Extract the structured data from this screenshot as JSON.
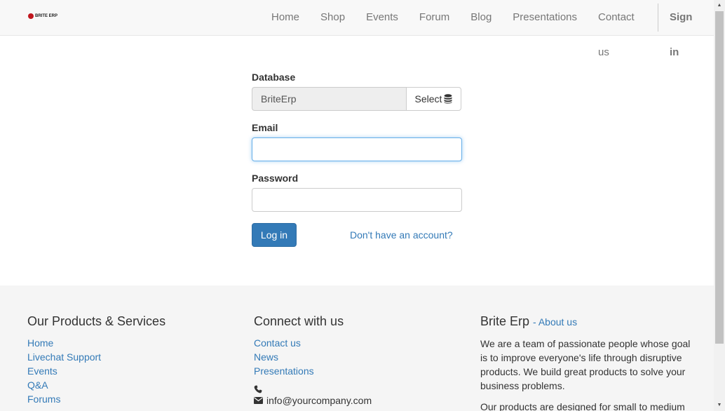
{
  "brand": {
    "logo_text": "BRITE ERP",
    "dot_color": "#c0161e"
  },
  "nav": {
    "items": [
      "Home",
      "Shop",
      "Events",
      "Forum",
      "Blog",
      "Presentations",
      "Contact us"
    ],
    "signin": "Sign in"
  },
  "login": {
    "database_label": "Database",
    "database_value": "BriteErp",
    "select_label": "Select",
    "email_label": "Email",
    "email_value": "",
    "password_label": "Password",
    "password_value": "",
    "login_button": "Log in",
    "signup_link": "Don't have an account?"
  },
  "footer": {
    "col1": {
      "title": "Our Products & Services",
      "links": [
        "Home",
        "Livechat Support",
        "Events",
        "Q&A",
        "Forums"
      ]
    },
    "col2": {
      "title": "Connect with us",
      "links": [
        "Contact us",
        "News",
        "Presentations"
      ],
      "email": "info@yourcompany.com"
    },
    "col3": {
      "title": "Brite Erp",
      "about_link": "- About us",
      "para1": "We are a team of passionate people whose goal is to improve everyone's life through disruptive products. We build great products to solve your business problems.",
      "para2": "Our products are designed for small to medium"
    }
  },
  "colors": {
    "primary": "#337ab7",
    "navbar_bg": "#f8f8f8",
    "footer_bg": "#f5f5f5"
  }
}
